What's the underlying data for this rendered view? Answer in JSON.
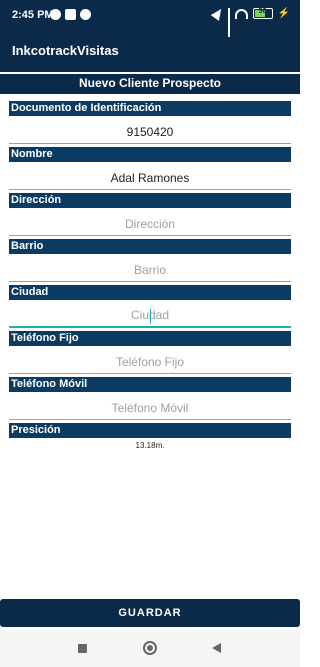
{
  "status_bar": {
    "time": "2:45 PM",
    "battery": "56"
  },
  "app": {
    "title": "InkcotrackVisitas"
  },
  "screen": {
    "title": "Nuevo Cliente Prospecto"
  },
  "fields": [
    {
      "label": "Documento de Identificación",
      "value": "9150420",
      "placeholder": ""
    },
    {
      "label": "Nombre",
      "value": "Adal Ramones",
      "placeholder": ""
    },
    {
      "label": "Dirección",
      "value": "",
      "placeholder": "Dirección"
    },
    {
      "label": "Barrio",
      "value": "",
      "placeholder": "Barrio"
    },
    {
      "label": "Ciudad",
      "value": "",
      "placeholder": "Ciudad"
    },
    {
      "label": "Teléfono Fijo",
      "value": "",
      "placeholder": "Teléfono Fijo"
    },
    {
      "label": "Teléfono Móvil",
      "value": "",
      "placeholder": "Teléfono Móvil"
    }
  ],
  "presicion": {
    "label": "Presición",
    "value": "13.18m."
  },
  "save_button": {
    "label": "GUARDAR"
  },
  "colors": {
    "header": "#0b2a4a",
    "label_bar": "#0b3b63",
    "focus": "#15b3b3"
  }
}
